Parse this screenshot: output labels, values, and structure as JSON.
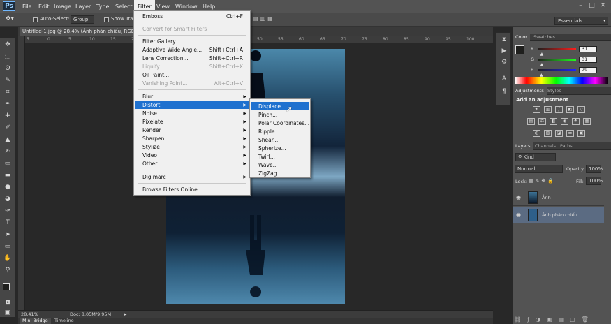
{
  "app": {
    "logo": "Ps"
  },
  "menubar": {
    "items": [
      "File",
      "Edit",
      "Image",
      "Layer",
      "Type",
      "Select",
      "Filter",
      "View",
      "Window",
      "Help"
    ]
  },
  "options": {
    "auto_select_label": "Auto-Select:",
    "auto_select_value": "Group",
    "show_transform": "Show Trans",
    "workspace": "Essentials"
  },
  "document": {
    "tab_title": "Untitled-1.jpg @ 28.4% (Ảnh phản chiếu, RGB/8",
    "zoom": "28.41%",
    "doc_size": "Doc: 8.05M/9.95M"
  },
  "ruler_top": [
    "5",
    "0",
    "5",
    "10",
    "15",
    "20",
    "25",
    "30",
    "35",
    "40",
    "45",
    "50",
    "55",
    "60",
    "65",
    "70",
    "75",
    "80",
    "85",
    "90",
    "95",
    "100"
  ],
  "filter_menu": {
    "items": [
      {
        "label": "Emboss",
        "shortcut": "Ctrl+F",
        "disabled": false
      },
      {
        "label": "Convert for Smart Filters",
        "shortcut": "",
        "disabled": true
      },
      {
        "label": "Filter Gallery...",
        "shortcut": "",
        "disabled": false
      },
      {
        "label": "Adaptive Wide Angle...",
        "shortcut": "Shift+Ctrl+A",
        "disabled": false
      },
      {
        "label": "Lens Correction...",
        "shortcut": "Shift+Ctrl+R",
        "disabled": false
      },
      {
        "label": "Liquify...",
        "shortcut": "Shift+Ctrl+X",
        "disabled": true
      },
      {
        "label": "Oil Paint...",
        "shortcut": "",
        "disabled": false
      },
      {
        "label": "Vanishing Point...",
        "shortcut": "Alt+Ctrl+V",
        "disabled": true
      },
      {
        "label": "Blur",
        "shortcut": "",
        "disabled": false
      },
      {
        "label": "Distort",
        "shortcut": "",
        "disabled": false
      },
      {
        "label": "Noise",
        "shortcut": "",
        "disabled": false
      },
      {
        "label": "Pixelate",
        "shortcut": "",
        "disabled": false
      },
      {
        "label": "Render",
        "shortcut": "",
        "disabled": false
      },
      {
        "label": "Sharpen",
        "shortcut": "",
        "disabled": false
      },
      {
        "label": "Stylize",
        "shortcut": "",
        "disabled": false
      },
      {
        "label": "Video",
        "shortcut": "",
        "disabled": false
      },
      {
        "label": "Other",
        "shortcut": "",
        "disabled": false
      },
      {
        "label": "Digimarc",
        "shortcut": "",
        "disabled": false
      },
      {
        "label": "Browse Filters Online...",
        "shortcut": "",
        "disabled": false
      }
    ]
  },
  "distort_menu": {
    "items": [
      "Displace...",
      "Pinch...",
      "Polar Coordinates...",
      "Ripple...",
      "Shear...",
      "Spherize...",
      "Twirl...",
      "Wave...",
      "ZigZag..."
    ]
  },
  "color_panel": {
    "tabs": [
      "Color",
      "Swatches"
    ],
    "r": {
      "label": "R",
      "value": "31",
      "fraction": 0.12
    },
    "g": {
      "label": "G",
      "value": "31",
      "fraction": 0.12
    },
    "b": {
      "label": "B",
      "value": "29",
      "fraction": 0.11
    }
  },
  "adjustments_panel": {
    "tabs": [
      "Adjustments",
      "Styles"
    ],
    "heading": "Add an adjustment"
  },
  "layers_panel": {
    "tabs": [
      "Layers",
      "Channels",
      "Paths"
    ],
    "kind": "Kind",
    "blend_mode": "Normal",
    "opacity_label": "Opacity:",
    "opacity": "100%",
    "lock_label": "Lock:",
    "fill_label": "Fill:",
    "fill": "100%",
    "layers": [
      {
        "name": "Ảnh",
        "selected": false
      },
      {
        "name": "Ảnh phản chiếu",
        "selected": true
      }
    ]
  },
  "bottom_tabs": [
    "Mini Bridge",
    "Timeline"
  ],
  "colors": {
    "menu_highlight": "#1f71cf",
    "panel_bg": "#535353",
    "workspace_bg": "#282828"
  }
}
